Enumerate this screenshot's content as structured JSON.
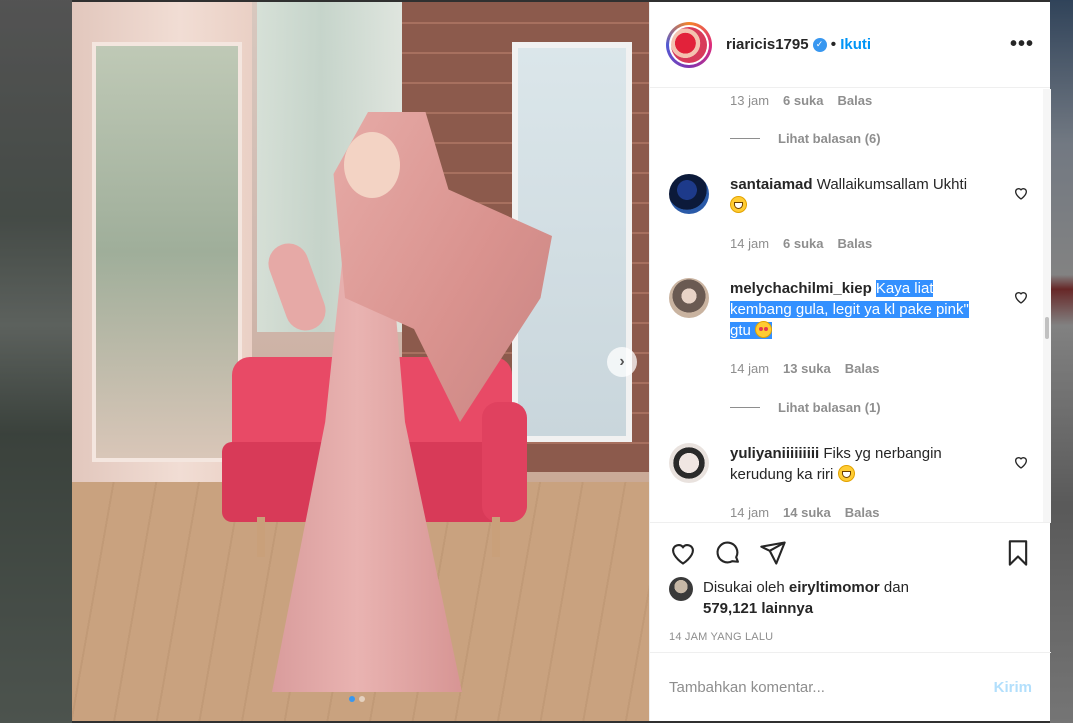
{
  "post": {
    "username": "riaricis1795",
    "follow_label": "Ikuti",
    "separator": "•",
    "more_label": "•••"
  },
  "comments": {
    "top_meta": {
      "time": "13 jam",
      "likes": "6 suka",
      "reply": "Balas"
    },
    "top_view_replies": "Lihat balasan (6)",
    "items": [
      {
        "username": "santaiamad",
        "text": "Wallaikumsallam Ukhti",
        "time": "14 jam",
        "likes": "6 suka",
        "reply": "Balas"
      },
      {
        "username": "melychachilmi_kiep",
        "text": "Kaya liat kembang gula, legit ya kl pake pink\" gtu",
        "time": "14 jam",
        "likes": "13 suka",
        "reply": "Balas",
        "view_replies": "Lihat balasan (1)"
      },
      {
        "username": "yuliyaniiiiiiiii",
        "text": "Fiks yg nerbangin kerudung ka riri",
        "time": "14 jam",
        "likes": "14 suka",
        "reply": "Balas"
      }
    ]
  },
  "likes": {
    "prefix": "Disukai oleh",
    "user": "eiryltimomor",
    "connector": "dan",
    "others": "579,121 lainnya"
  },
  "timestamp": "14 JAM YANG LALU",
  "comment_input": {
    "placeholder": "Tambahkan komentar...",
    "post_label": "Kirim"
  },
  "colors": {
    "accent": "#0095f6",
    "highlight": "#3390ff",
    "post_disabled": "#b2dffc"
  },
  "icons": [
    "chevron-right-icon",
    "verified-icon",
    "more-icon",
    "heart-icon",
    "comment-icon",
    "share-icon",
    "bookmark-icon"
  ],
  "carousel": {
    "slides": 2,
    "active": 1
  }
}
